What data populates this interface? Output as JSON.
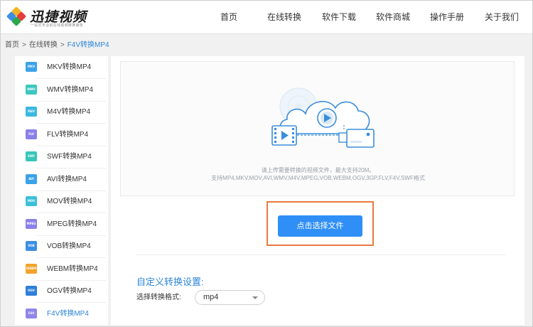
{
  "header": {
    "logo_name": "迅捷视频",
    "logo_slogan": "一站式专业的在线视频转换服务",
    "nav": [
      {
        "label": "首页"
      },
      {
        "label": "在线转换"
      },
      {
        "label": "软件下载"
      },
      {
        "label": "软件商城"
      },
      {
        "label": "操作手册"
      },
      {
        "label": "关于我们"
      }
    ]
  },
  "breadcrumb": {
    "home": "首页",
    "separator": ">",
    "online": "在线转换",
    "current": "F4V转换MP4"
  },
  "sidebar": {
    "items": [
      {
        "icon": "MKV",
        "label": "MKV转换MP4",
        "color": "#3aa3e8"
      },
      {
        "icon": "WMV",
        "label": "WMV转换MP4",
        "color": "#3cc7c0"
      },
      {
        "icon": "M4V",
        "label": "M4V转换MP4",
        "color": "#3bb8e0"
      },
      {
        "icon": "FLV",
        "label": "FLV转换MP4",
        "color": "#8a80e8"
      },
      {
        "icon": "SWF",
        "label": "SWF转换MP4",
        "color": "#36c6b8"
      },
      {
        "icon": "AVI",
        "label": "AVI转换MP4",
        "color": "#3aa3e8"
      },
      {
        "icon": "MOV",
        "label": "MOV转换MP4",
        "color": "#3cc0d8"
      },
      {
        "icon": "MPEG",
        "label": "MPEG转换MP4",
        "color": "#8a80e8"
      },
      {
        "icon": "VOB",
        "label": "VOB转换MP4",
        "color": "#3b8fe3"
      },
      {
        "icon": "WEBM",
        "label": "WEBM转换MP4",
        "color": "#f3a32a"
      },
      {
        "icon": "OGV",
        "label": "OGV转换MP4",
        "color": "#2f7fd8"
      },
      {
        "icon": "F4V",
        "label": "F4V转换MP4",
        "color": "#8f86e8",
        "active": true
      }
    ]
  },
  "upload": {
    "hint_line1": "请上传需要转换的视频文件，最大支持20M。",
    "hint_line2": "支持MP4,MKV,MOV,AVI,WMV,M4V,MPEG,VOB,WEBM,OGV,3GP,FLV,F4V,SWF格式",
    "button_label": "点击选择文件"
  },
  "settings": {
    "title": "自定义转换设置:",
    "format_label": "选择转换格式:",
    "format_value": "mp4"
  },
  "colors": {
    "accent": "#2d86d9",
    "button": "#2f8ff6",
    "highlight_border": "#ea7a3d"
  }
}
